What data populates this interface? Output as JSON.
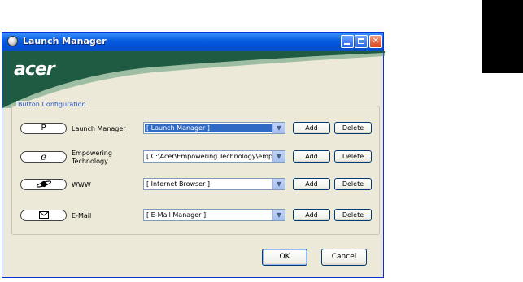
{
  "window": {
    "title": "Launch Manager"
  },
  "logo": {
    "text": "acer"
  },
  "group": {
    "title": "Button Configuration"
  },
  "rows": [
    {
      "button_glyph": "P",
      "label": "Launch Manager",
      "selected_value": "[ Launch Manager ]",
      "add_label": "Add",
      "delete_label": "Delete"
    },
    {
      "button_glyph": "e",
      "label_line1": "Empowering",
      "label_line2": "Technology",
      "selected_value": "[ C:\\Acer\\Empowering Technology\\emp",
      "add_label": "Add",
      "delete_label": "Delete"
    },
    {
      "button_glyph": "www-icon",
      "label": "WWW",
      "selected_value": "[ Internet Browser ]",
      "add_label": "Add",
      "delete_label": "Delete"
    },
    {
      "button_glyph": "email-icon",
      "label": "E-Mail",
      "selected_value": "[ E-Mail Manager ]",
      "add_label": "Add",
      "delete_label": "Delete"
    }
  ],
  "footer": {
    "ok_label": "OK",
    "cancel_label": "Cancel"
  },
  "colors": {
    "titlebar": "#0a5fe0",
    "banner_green": "#1f5b43",
    "dialog_bg": "#ece9d8",
    "selection": "#316ac5"
  }
}
